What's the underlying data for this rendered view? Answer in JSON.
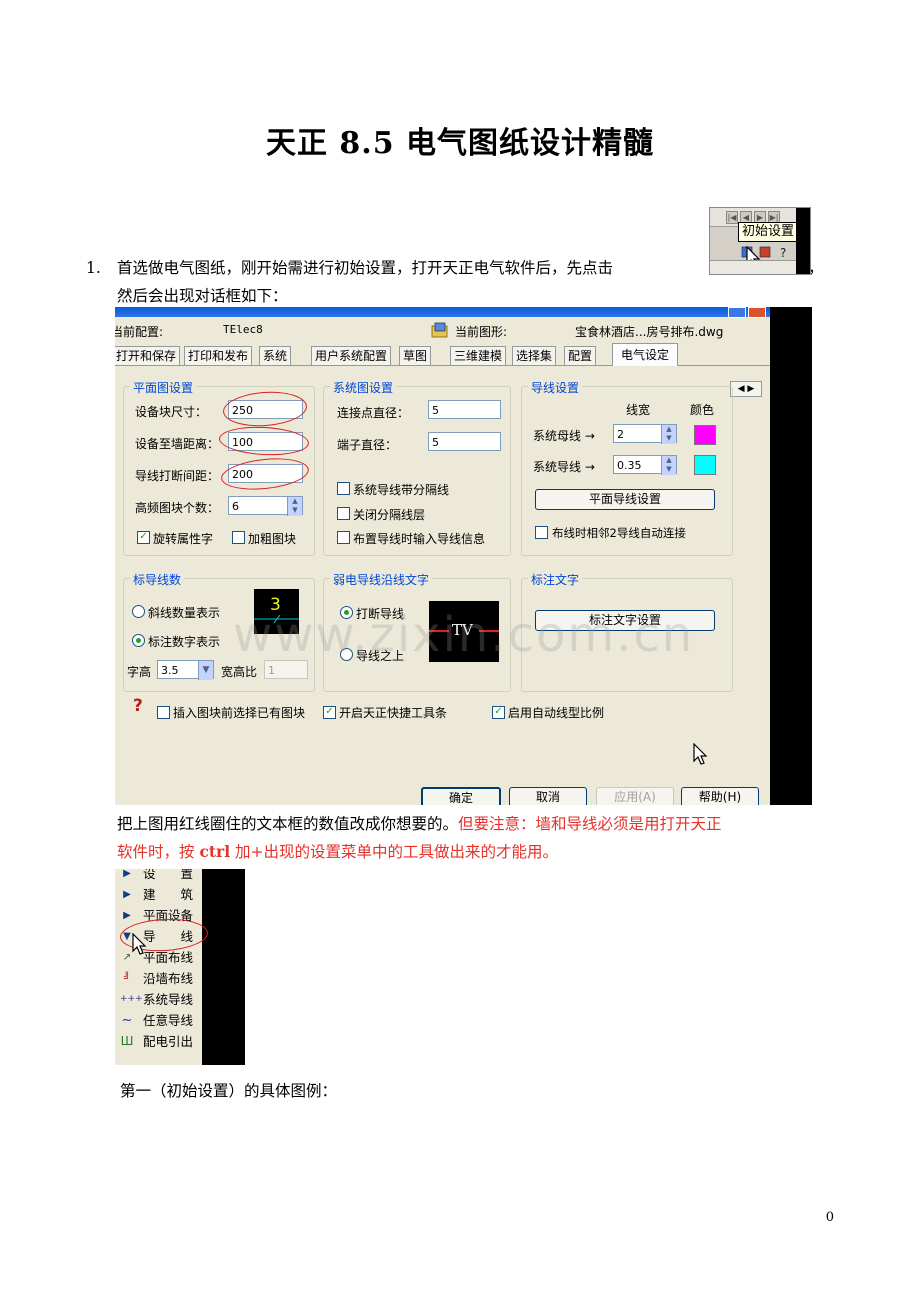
{
  "doc": {
    "title": "天正 8.5 电气图纸设计精髓",
    "item1_num": "1.",
    "item1_line1": "首选做电气图纸，刚开始需进行初始设置，打开天正电气软件后，先点击",
    "item1_comma": "，",
    "item1_line2": "然后会出现对话框如下：",
    "para2_black": "把上图用红线圈住的文本框的数值改成你想要的。",
    "para2_red1": "但要注意：墙和导线必须是用打开天正",
    "para2_red2a": "软件时，按 ",
    "para2_red2b": "ctrl",
    "para2_red2c": " 加+出现的设置菜单中的工具做出来的才能用。",
    "para3": "第一（初始设置）的具体图例：",
    "page_number": "0"
  },
  "toolbar_img": {
    "tooltip": "初始设置"
  },
  "dialog": {
    "cfg_label": "当前配置:",
    "cfg_value": "TElec8",
    "drawing_label": "当前图形:",
    "drawing_value": "宝食林酒店...房号排布.dwg",
    "tabs": [
      "打开和保存",
      "打印和发布",
      "系统",
      "用户系统配置",
      "草图",
      "三维建模",
      "选择集",
      "配置",
      "电气设定"
    ],
    "plan": {
      "title": "平面图设置",
      "block_size_label": "设备块尺寸：",
      "block_size_value": "250",
      "wall_dist_label": "设备至墙距离：",
      "wall_dist_value": "100",
      "break_gap_label": "导线打断间距：",
      "break_gap_value": "200",
      "freq_blocks_label": "高频图块个数：",
      "freq_blocks_value": "6",
      "rotate_attr": "旋转属性字",
      "bold_block": "加粗图块"
    },
    "system": {
      "title": "系统图设置",
      "node_diam_label": "连接点直径：",
      "node_diam_value": "5",
      "terminal_diam_label": "端子直径：",
      "terminal_diam_value": "5",
      "opt1": "系统导线带分隔线",
      "opt2": "关闭分隔线层",
      "opt3": "布置导线时输入导线信息"
    },
    "wire": {
      "title": "导线设置",
      "width_header": "线宽",
      "color_header": "颜色",
      "bus_label": "系统母线 →",
      "bus_width": "2",
      "bus_color": "#ff00ff",
      "wire_label": "系统导线 →",
      "wire_width": "0.35",
      "wire_color": "#00ffff",
      "plan_wire_btn": "平面导线设置",
      "auto_connect": "布线时相邻2导线自动连接"
    },
    "mark_count": {
      "title": "标导线数",
      "opt_slash": "斜线数量表示",
      "opt_number": "标注数字表示",
      "char_height_label": "字高",
      "char_height_value": "3.5",
      "aspect_label": "宽高比",
      "aspect_value": "1",
      "preview_text": "3"
    },
    "weak": {
      "title": "弱电导线沿线文字",
      "opt_break": "打断导线",
      "opt_above": "导线之上",
      "preview_text": "TV"
    },
    "annot": {
      "title": "标注文字",
      "btn": "标注文字设置"
    },
    "bottom": {
      "help_icon": "?",
      "opt_insert": "插入图块前选择已有图块",
      "opt_toolbar": "开启天正快捷工具条",
      "opt_linescale": "启用自动线型比例"
    },
    "buttons": {
      "ok": "确定",
      "cancel": "取消",
      "apply": "应用(A)",
      "help": "帮助(H)"
    }
  },
  "watermark": "www.zixin.com.cn",
  "menu_img": {
    "items": [
      {
        "icon": "▶",
        "label": "设　　置"
      },
      {
        "icon": "▶",
        "label": "建　　筑"
      },
      {
        "icon": "▶",
        "label": "平面设备"
      },
      {
        "icon": "▼",
        "label": "导　　线"
      },
      {
        "icon": "↗",
        "label": "平面布线"
      },
      {
        "icon": "╝",
        "label": "沿墙布线"
      },
      {
        "icon": "+++",
        "label": "系统导线"
      },
      {
        "icon": "~",
        "label": "任意导线"
      },
      {
        "icon": "Ш",
        "label": "配电引出"
      }
    ]
  }
}
